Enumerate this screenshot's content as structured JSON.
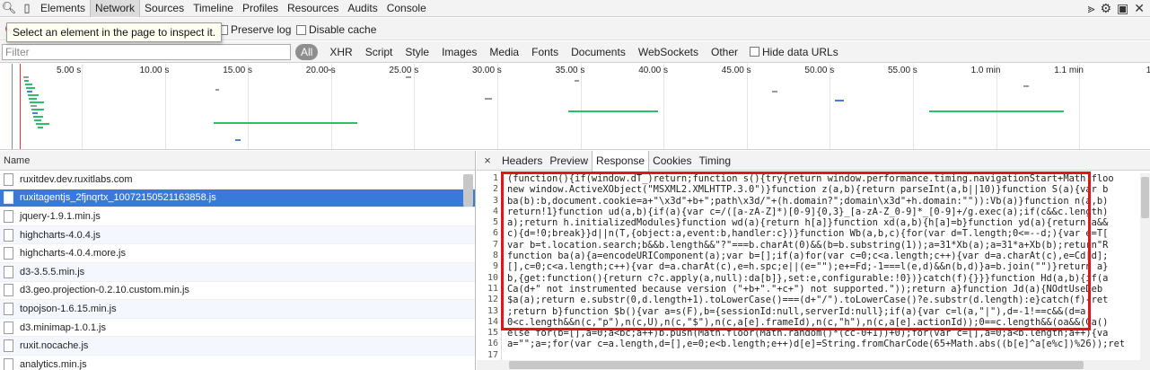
{
  "toolbar": {
    "tabs": [
      "Elements",
      "Network",
      "Sources",
      "Timeline",
      "Profiles",
      "Resources",
      "Audits",
      "Console"
    ],
    "active_tab": "Network"
  },
  "row2": {
    "tooltip": "Select an element in the page to inspect it.",
    "preserve_log": "Preserve log",
    "disable_cache": "Disable cache"
  },
  "filterbar": {
    "placeholder": "Filter",
    "types": [
      "All",
      "XHR",
      "Script",
      "Style",
      "Images",
      "Media",
      "Fonts",
      "Documents",
      "WebSockets",
      "Other"
    ],
    "hide_data_urls": "Hide data URLs"
  },
  "overview": {
    "ticks": [
      "5.00 s",
      "10.00 s",
      "15.00 s",
      "20.00 s",
      "25.00 s",
      "30.00 s",
      "35.00 s",
      "40.00 s",
      "45.00 s",
      "50.00 s",
      "55.00 s",
      "1.0 min",
      "1.1 min",
      "1.2"
    ]
  },
  "requests": {
    "header": "Name",
    "items": [
      "ruxitdev.dev.ruxitlabs.com",
      "ruxitagentjs_2fjnqrtx_10072150521163858.js",
      "jquery-1.9.1.min.js",
      "highcharts-4.0.4.js",
      "highcharts-4.0.4.more.js",
      "d3-3.5.5.min.js",
      "d3.geo.projection-0.2.10.custom.min.js",
      "topojson-1.6.15.min.js",
      "d3.minimap-1.0.1.js",
      "ruxit.nocache.js",
      "analytics.min.js"
    ],
    "selected_index": 1
  },
  "detail": {
    "close": "×",
    "tabs": [
      "Headers",
      "Preview",
      "Response",
      "Cookies",
      "Timing"
    ],
    "active_tab": "Response",
    "line_numbers": [
      "1",
      "2",
      "3",
      "4",
      "5",
      "6",
      "7",
      "8",
      "9",
      "10",
      "11",
      "12",
      "13",
      "14",
      "15",
      "16",
      "17"
    ],
    "code_lines": [
      "(function(){if(window.dT_)return;function s(){try{return window.performance.timing.navigationStart+Math.floo",
      "new window.ActiveXObject(\"MSXML2.XMLHTTP.3.0\")}function z(a,b){return parseInt(a,b||10)}function S(a){var b",
      "ba(b):b,document.cookie=a+\"\\x3d\"+b+\";path\\x3d/\"+(h.domain?\";domain\\x3d\"+h.domain:\"\")):Vb(a)}function n(a,b)",
      "return!1}function ud(a,b){if(a){var c=/([a-zA-Z]*)[0-9]{0,3}_[a-zA-Z_0-9]*_[0-9]+/g.exec(a);if(c&&c.length)",
      "a);return h.initializedModules}function wd(a){return h[a]}function xd(a,b){h[a]=b}function yd(a){return a&&",
      "c){d=!0;break}}d||n(T,{object:a,event:b,handler:c})}function Wb(a,b,c){for(var d=T.length;0<=--d;){var e=T[",
      "var b=t.location.search;b&&b.length&&\"?\"===b.charAt(0)&&(b=b.substring(1));a=31*Xb(a);a=31*a+Xb(b);return\"R",
      "function ba(a){a=encodeURIComponent(a);var b=[];if(a)for(var c=0;c<a.length;c++){var d=a.charAt(c),e=Cd[d];",
      "[],c=0;c<a.length;c++){var d=a.charAt(c),e=h.spc;e||(e=\"\");e+=Fd;-1===l(e,d)&&n(b,d)}a=b.join(\"\")}return a}",
      "b,{get:function(){return c?c.apply(a,null):da[b]},set:e,configurable:!0})}catch(f){}}}function Hd(a,b){if(a",
      "Ca(d+\" not instrumented because version (\"+b+\".\"+c+\") not supported.\"));return a}function Jd(a){NOdtUseDeb",
      "$a(a);return e.substr(0,d.length+1).toLowerCase()===(d+\"/\").toLowerCase()?e.substr(d.length):e}catch(f){ret",
      ";return b}function $b(){var a=s(F),b={sessionId:null,serverId:null};if(a){var c=l(a,\"|\"),d=-1!==c&&(d=a.",
      "0<c.length&&n(c,\"p\"),n(c,U),n(c,\"$\"),n(c,a[e].frameId),n(c,\"h\"),n(c,a[e].actionId));0==c.length&&(oa&&(Ga()",
      "else for(b=[],a=0;a<bc;a++)b.push(Math.floor(Math.random()*(cc-0+1))+0);for(var c=[],a=0;a<b.length;a++){va",
      "a=\"\";a=;for(var c=a.length,d=[],e=0;e<b.length;e++)d[e]=String.fromCharCode(65+Math.abs((b[e]^a[e%c])%26));ret",
      ""
    ]
  }
}
